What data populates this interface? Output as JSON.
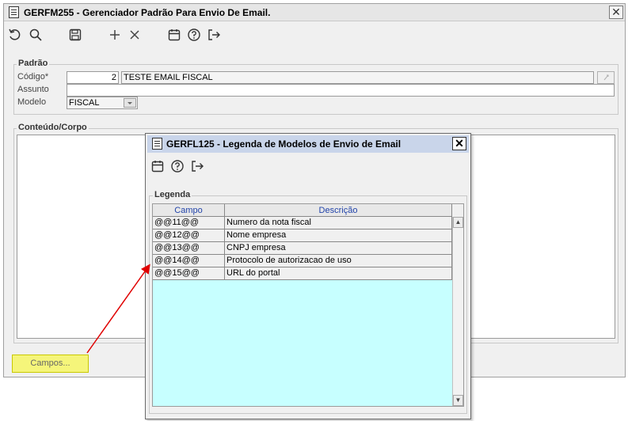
{
  "main": {
    "title": "GERFM255 - Gerenciador Padrão Para Envio De Email.",
    "close_label": "✕",
    "toolbar": [
      {
        "name": "undo-icon",
        "glyph": "↺"
      },
      {
        "name": "search-icon",
        "glyph": "🔍"
      },
      {
        "name": "save-icon",
        "glyph": "💾"
      },
      {
        "name": "add-icon",
        "glyph": "+"
      },
      {
        "name": "delete-icon",
        "glyph": "✕"
      },
      {
        "name": "calendar-icon",
        "glyph": "📅"
      },
      {
        "name": "help-icon",
        "glyph": "?"
      },
      {
        "name": "exit-icon",
        "glyph": "⇥"
      }
    ],
    "padrao": {
      "legend": "Padrão",
      "codigo_label": "Código*",
      "codigo_value": "2",
      "codigo_desc": "TESTE EMAIL FISCAL",
      "assunto_label": "Assunto",
      "assunto_value": "",
      "modelo_label": "Modelo",
      "modelo_value": "FISCAL"
    },
    "conteudo": {
      "legend": "Conteúdo/Corpo"
    },
    "campos_button": "Campos..."
  },
  "dialog": {
    "title": "GERFL125 - Legenda de Modelos de Envio de Email",
    "close_label": "✕",
    "legend": "Legenda",
    "columns": [
      "Campo",
      "Descrição"
    ],
    "rows": [
      {
        "campo": "@@11@@",
        "descricao": "Numero da nota fiscal"
      },
      {
        "campo": "@@12@@",
        "descricao": "Nome empresa"
      },
      {
        "campo": "@@13@@",
        "descricao": "CNPJ empresa"
      },
      {
        "campo": "@@14@@",
        "descricao": "Protocolo de autorizacao de uso"
      },
      {
        "campo": "@@15@@",
        "descricao": "URL do portal"
      }
    ]
  },
  "colors": {
    "grid_empty": "#c7ffff",
    "button_yellow": "#f5f57a",
    "arrow": "#e00000",
    "dialog_title": "#c9d5ea"
  }
}
